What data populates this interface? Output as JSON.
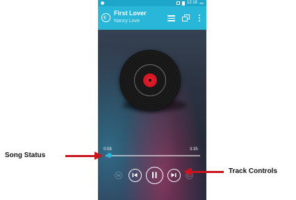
{
  "status_bar": {
    "time": "12:18",
    "ampm": "AM"
  },
  "header": {
    "title": "First Lover",
    "artist": "Nancy Love"
  },
  "player": {
    "elapsed": "0:08",
    "duration": "3:35",
    "progress": 0.037
  },
  "annotations": {
    "song_status": "Song Status",
    "track_controls": "Track Controls"
  },
  "colors": {
    "accent": "#28b7d8",
    "arrow": "#c8141a",
    "record_label": "#e9222f"
  }
}
